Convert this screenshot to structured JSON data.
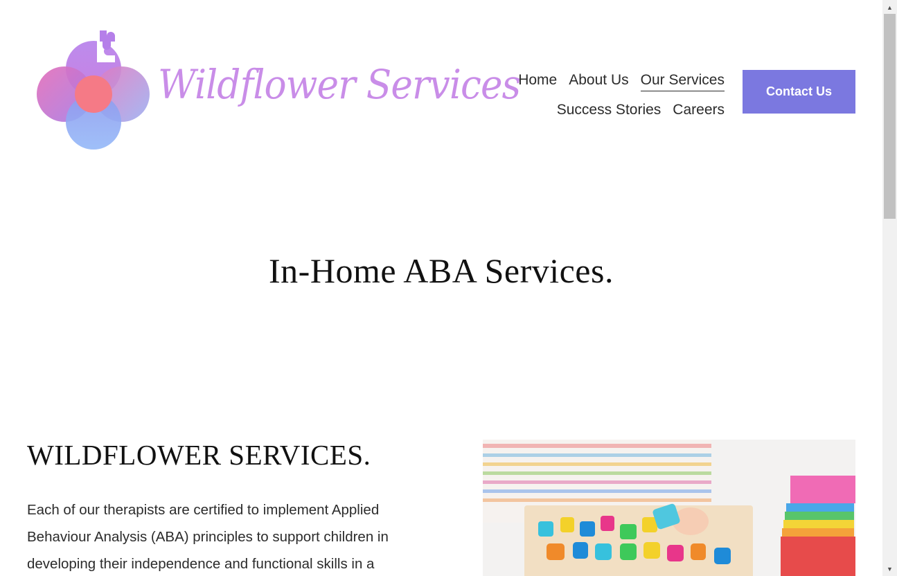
{
  "header": {
    "logo_text": "Wildflower Services",
    "nav": [
      {
        "label": "Home",
        "active": false
      },
      {
        "label": "About Us",
        "active": false
      },
      {
        "label": "Our Services",
        "active": true
      },
      {
        "label": "Success Stories",
        "active": false
      },
      {
        "label": "Careers",
        "active": false
      }
    ],
    "cta_label": "Contact Us"
  },
  "hero": {
    "title": "In-Home ABA Services."
  },
  "section": {
    "title": "WILDFLOWER SERVICES.",
    "body": "Each of our therapists are certified to implement Applied Behaviour Analysis (ABA) principles to support children in developing their independence and functional skills in a"
  },
  "colors": {
    "accent": "#7b78e0",
    "logo_text": "#c98de8",
    "petal_pink": "#e77ab8",
    "petal_purple": "#b57fe9",
    "petal_blue": "#8fb1f3",
    "center": "#f57a86"
  },
  "icons": {
    "scroll_up": "triangle-up-icon",
    "scroll_down": "triangle-down-icon"
  }
}
